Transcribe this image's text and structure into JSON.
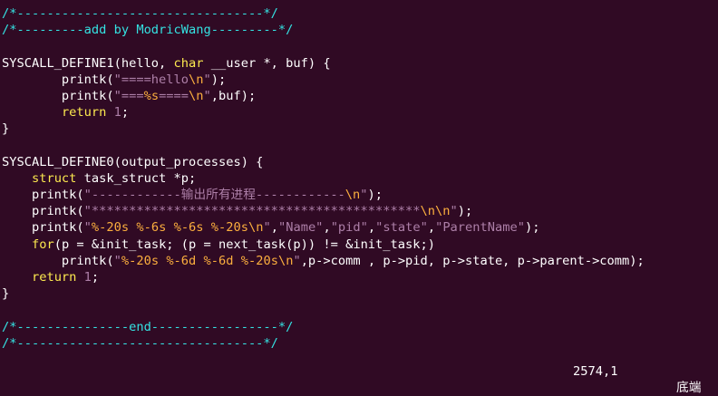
{
  "editor": {
    "lines": [
      [
        {
          "t": "comment",
          "v": "/*---------------------------------*/"
        }
      ],
      [
        {
          "t": "comment",
          "v": "/*---------add by ModricWang---------*/"
        }
      ],
      [],
      [
        {
          "t": "plain",
          "v": "SYSCALL_DEFINE1(hello, "
        },
        {
          "t": "type",
          "v": "char"
        },
        {
          "t": "plain",
          "v": " __user *, buf) {"
        }
      ],
      [
        {
          "t": "plain",
          "v": "        printk("
        },
        {
          "t": "string",
          "v": "\"====hello"
        },
        {
          "t": "special",
          "v": "\\n"
        },
        {
          "t": "string",
          "v": "\""
        },
        {
          "t": "plain",
          "v": ");"
        }
      ],
      [
        {
          "t": "plain",
          "v": "        printk("
        },
        {
          "t": "string",
          "v": "\"==="
        },
        {
          "t": "special",
          "v": "%s"
        },
        {
          "t": "string",
          "v": "===="
        },
        {
          "t": "special",
          "v": "\\n"
        },
        {
          "t": "string",
          "v": "\""
        },
        {
          "t": "plain",
          "v": ",buf);"
        }
      ],
      [
        {
          "t": "plain",
          "v": "        "
        },
        {
          "t": "keyword",
          "v": "return"
        },
        {
          "t": "plain",
          "v": " "
        },
        {
          "t": "number",
          "v": "1"
        },
        {
          "t": "plain",
          "v": ";"
        }
      ],
      [
        {
          "t": "plain",
          "v": "}"
        }
      ],
      [],
      [
        {
          "t": "plain",
          "v": "SYSCALL_DEFINE0(output_processes) {"
        }
      ],
      [
        {
          "t": "plain",
          "v": "    "
        },
        {
          "t": "type",
          "v": "struct"
        },
        {
          "t": "plain",
          "v": " task_struct *p;"
        }
      ],
      [
        {
          "t": "plain",
          "v": "    printk("
        },
        {
          "t": "string",
          "v": "\"------------输出所有进程------------"
        },
        {
          "t": "special",
          "v": "\\n"
        },
        {
          "t": "string",
          "v": "\""
        },
        {
          "t": "plain",
          "v": ");"
        }
      ],
      [
        {
          "t": "plain",
          "v": "    printk("
        },
        {
          "t": "string",
          "v": "\"********************************************"
        },
        {
          "t": "special",
          "v": "\\n\\n"
        },
        {
          "t": "string",
          "v": "\""
        },
        {
          "t": "plain",
          "v": ");"
        }
      ],
      [
        {
          "t": "plain",
          "v": "    printk("
        },
        {
          "t": "string",
          "v": "\""
        },
        {
          "t": "special",
          "v": "%-20s"
        },
        {
          "t": "string",
          "v": " "
        },
        {
          "t": "special",
          "v": "%-6s"
        },
        {
          "t": "string",
          "v": " "
        },
        {
          "t": "special",
          "v": "%-6s"
        },
        {
          "t": "string",
          "v": " "
        },
        {
          "t": "special",
          "v": "%-20s\\n"
        },
        {
          "t": "string",
          "v": "\""
        },
        {
          "t": "plain",
          "v": ","
        },
        {
          "t": "string",
          "v": "\"Name\""
        },
        {
          "t": "plain",
          "v": ","
        },
        {
          "t": "string",
          "v": "\"pid\""
        },
        {
          "t": "plain",
          "v": ","
        },
        {
          "t": "string",
          "v": "\"state\""
        },
        {
          "t": "plain",
          "v": ","
        },
        {
          "t": "string",
          "v": "\"ParentName\""
        },
        {
          "t": "plain",
          "v": ");"
        }
      ],
      [
        {
          "t": "plain",
          "v": "    "
        },
        {
          "t": "keyword",
          "v": "for"
        },
        {
          "t": "plain",
          "v": "(p = &init_task; (p = next_task(p)) != &init_task;)"
        }
      ],
      [
        {
          "t": "plain",
          "v": "        printk("
        },
        {
          "t": "string",
          "v": "\""
        },
        {
          "t": "special",
          "v": "%-20s"
        },
        {
          "t": "string",
          "v": " "
        },
        {
          "t": "special",
          "v": "%-6d"
        },
        {
          "t": "string",
          "v": " "
        },
        {
          "t": "special",
          "v": "%-6d"
        },
        {
          "t": "string",
          "v": " "
        },
        {
          "t": "special",
          "v": "%-20s\\n"
        },
        {
          "t": "string",
          "v": "\""
        },
        {
          "t": "plain",
          "v": ",p->comm , p->pid, p->state, p->parent->comm);"
        }
      ],
      [
        {
          "t": "plain",
          "v": "    "
        },
        {
          "t": "keyword",
          "v": "return"
        },
        {
          "t": "plain",
          "v": " "
        },
        {
          "t": "number",
          "v": "1"
        },
        {
          "t": "plain",
          "v": ";"
        }
      ],
      [
        {
          "t": "plain",
          "v": "}"
        }
      ],
      [],
      [
        {
          "t": "comment",
          "v": "/*---------------end-----------------*/"
        }
      ],
      [
        {
          "t": "comment",
          "v": "/*---------------------------------*/"
        }
      ]
    ]
  },
  "status_bar": {
    "cursor_position": "2574,1",
    "scroll_position": "底端"
  },
  "colors": {
    "background": "#300a24",
    "comment": "#34e2e2",
    "type_keyword": "#fce94f",
    "string": "#ad7fa8",
    "format_specifier": "#fcaf3e",
    "plain_text": "#ffffff"
  }
}
